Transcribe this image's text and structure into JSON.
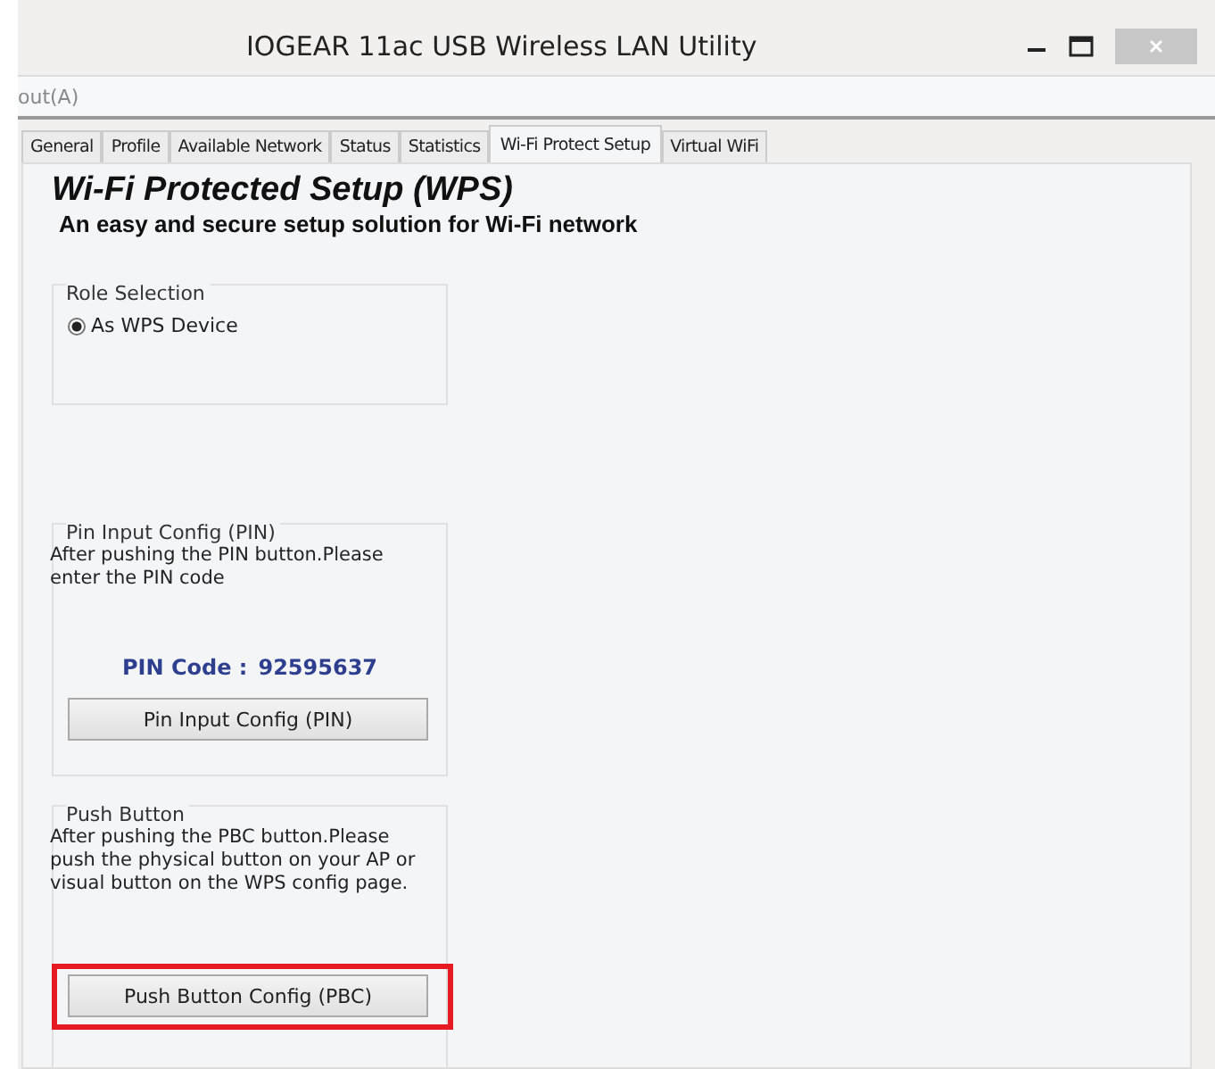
{
  "window": {
    "title": "IOGEAR 11ac USB Wireless LAN Utility"
  },
  "menu": [
    "out(A)"
  ],
  "tabs": [
    {
      "label": "General",
      "selected": false
    },
    {
      "label": "Profile",
      "selected": false
    },
    {
      "label": "Available Network",
      "selected": false
    },
    {
      "label": "Status",
      "selected": false
    },
    {
      "label": "Statistics",
      "selected": false
    },
    {
      "label": "Wi-Fi Protect Setup",
      "selected": true
    },
    {
      "label": "Virtual WiFi",
      "selected": false
    }
  ],
  "heading": "Wi-Fi Protected Setup (WPS)",
  "subheading": "An easy and secure setup solution for Wi-Fi network",
  "role_selection": {
    "title": "Role Selection",
    "options": [
      {
        "label": "As WPS Device",
        "selected": true
      }
    ]
  },
  "pin": {
    "title": "Pin Input Config (PIN)",
    "description": "After pushing the PIN button.Please enter the PIN code",
    "pin_label": "PIN Code :",
    "pin_value": "92595637",
    "button": "Pin Input Config (PIN)"
  },
  "push": {
    "title": "Push Button",
    "description": "After pushing the PBC button.Please push the physical button on your AP or visual button on the WPS config page.",
    "button": "Push Button Config (PBC)",
    "highlighted": true
  }
}
